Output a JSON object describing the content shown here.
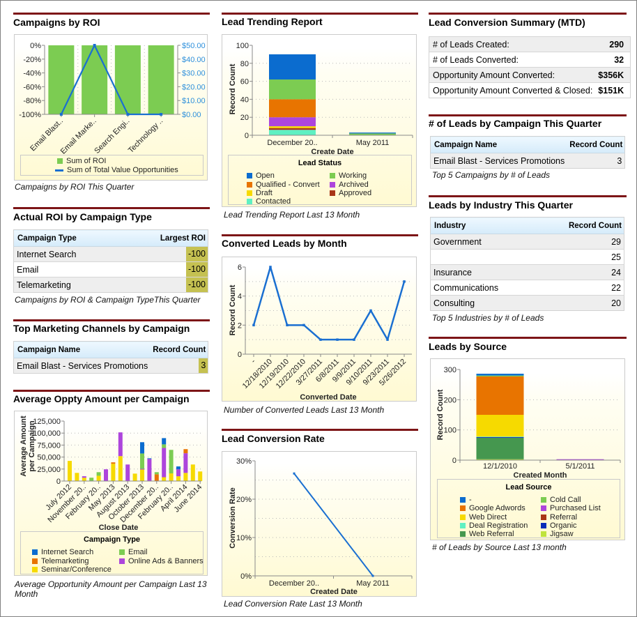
{
  "theme": {
    "section_rule": "#7d1517",
    "highlight_cell": "#c5c151"
  },
  "campaigns_by_roi": {
    "title": "Campaigns by ROI",
    "caption": "Campaigns by ROI This Quarter"
  },
  "actual_roi": {
    "title": "Actual ROI by Campaign Type",
    "columns": [
      "Campaign Type",
      "Largest ROI"
    ],
    "rows": [
      [
        "Internet Search",
        "-100"
      ],
      [
        "Email",
        "-100"
      ],
      [
        "Telemarketing",
        "-100"
      ]
    ],
    "caption": "Campaigns by ROI & Campaign TypeThis Quarter"
  },
  "top_channels": {
    "title": "Top Marketing Channels by Campaign",
    "columns": [
      "Campaign Name",
      "Record Count"
    ],
    "rows": [
      [
        "Email Blast - Services Promotions",
        "3"
      ]
    ]
  },
  "avg_oppty": {
    "title": "Average Oppty Amount per Campaign",
    "caption": "Average Opportunity Amount per Campaign Last 13 Month"
  },
  "lead_trending": {
    "title": "Lead Trending Report",
    "caption": "Lead Trending Report Last 13 Month"
  },
  "converted_leads": {
    "title": "Converted Leads by Month",
    "caption": "Number of Converted Leads Last 13 Month"
  },
  "conversion_rate": {
    "title": "Lead Conversion Rate",
    "caption": "Lead Conversion Rate Last 13 Month"
  },
  "conversion_summary": {
    "title": "Lead Conversion Summary (MTD)",
    "rows": [
      [
        "# of Leads Created:",
        "290"
      ],
      [
        "# of Leads Converted:",
        "32"
      ],
      [
        "Opportunity Amount Converted:",
        "$356K"
      ],
      [
        "Opportunity Amount Converted & Closed:",
        "$151K"
      ]
    ]
  },
  "leads_by_campaign": {
    "title": "# of Leads by Campaign This Quarter",
    "columns": [
      "Campaign Name",
      "Record Count"
    ],
    "rows": [
      [
        "Email Blast - Services Promotions",
        "3"
      ]
    ],
    "caption": "Top 5 Campaigns by # of Leads"
  },
  "leads_by_industry": {
    "title": "Leads by Industry This Quarter",
    "columns": [
      "Industry",
      "Record Count"
    ],
    "rows": [
      [
        "Government",
        "29"
      ],
      [
        "",
        "25"
      ],
      [
        "Insurance",
        "24"
      ],
      [
        "Communications",
        "22"
      ],
      [
        "Consulting",
        "20"
      ]
    ],
    "caption": "Top 5 Industries by # of Leads"
  },
  "leads_by_source": {
    "title": "Leads by Source",
    "caption": "# of Leads by Source Last 13 month"
  },
  "chart_data": [
    {
      "type": "bar+line",
      "title": "Campaigns by ROI",
      "categories": [
        "Email Blast..",
        "Email Marke..",
        "Search Engi..",
        "Technology .."
      ],
      "series": [
        {
          "name": "Sum of ROI",
          "kind": "bar",
          "axis": "left",
          "color": "#7ccc52",
          "values": [
            -100,
            -100,
            -100,
            -100
          ]
        },
        {
          "name": "Sum of Total Value Opportunities",
          "kind": "line",
          "axis": "right",
          "color": "#1a6fd1",
          "values": [
            0,
            50,
            0,
            0
          ]
        }
      ],
      "y_left": {
        "min": -100,
        "max": 0,
        "ticks": [
          0,
          -20,
          -40,
          -60,
          -80,
          -100
        ],
        "tick_labels": [
          "0%",
          "-20%",
          "-40%",
          "-60%",
          "-80%",
          "-100%"
        ]
      },
      "y_right": {
        "min": 0,
        "max": 50,
        "ticks": [
          50,
          40,
          30,
          20,
          10,
          0
        ],
        "tick_labels": [
          "$50.00",
          "$40.00",
          "$30.00",
          "$20.00",
          "$10.00",
          "$0.00"
        ],
        "color": "#2d8fdb"
      },
      "legend": {
        "position": "bottom"
      }
    },
    {
      "type": "bar",
      "stacked": true,
      "title": "Lead Trending Report",
      "categories": [
        "December 20..",
        "May 2011"
      ],
      "xlabel": "Create Date",
      "ylabel": "Record Count",
      "y": {
        "min": 0,
        "max": 100,
        "ticks": [
          0,
          20,
          40,
          60,
          80,
          100
        ],
        "tick_labels": [
          "0",
          "20",
          "40",
          "60",
          "80",
          "100"
        ],
        "gridlines": [
          20,
          40,
          60,
          80
        ]
      },
      "legend": {
        "title": "Lead Status",
        "position": "bottom"
      },
      "series": [
        {
          "name": "Open",
          "color": "#0b6ccf",
          "values": [
            28,
            1
          ]
        },
        {
          "name": "Working",
          "color": "#7ccc52",
          "values": [
            22,
            2
          ]
        },
        {
          "name": "Qualified - Convert",
          "color": "#e87400",
          "values": [
            20,
            0
          ]
        },
        {
          "name": "Archived",
          "color": "#ad45dc",
          "values": [
            10,
            0
          ]
        },
        {
          "name": "Draft",
          "color": "#f6da00",
          "values": [
            2,
            0
          ]
        },
        {
          "name": "Approved",
          "color": "#a83517",
          "values": [
            2,
            0
          ]
        },
        {
          "name": "Contacted",
          "color": "#5ff0c2",
          "values": [
            6,
            0
          ]
        }
      ]
    },
    {
      "type": "line",
      "title": "Converted Leads by Month",
      "categories": [
        "-",
        "12/18/2010",
        "12/19/2010",
        "12/22/2010",
        "3/27/2011",
        "6/8/2011",
        "9/9/2011",
        "9/10/2011",
        "9/23/2011",
        "5/26/2012"
      ],
      "xlabel": "Converted Date",
      "ylabel": "Record Count",
      "y": {
        "min": 0,
        "max": 6,
        "ticks": [
          0,
          2,
          4,
          6
        ],
        "tick_labels": [
          "0",
          "2",
          "4",
          "6"
        ],
        "gridlines": [
          1,
          2,
          3,
          4,
          5
        ]
      },
      "series": [
        {
          "name": "Record Count",
          "color": "#1a6fd1",
          "values": [
            2,
            6,
            2,
            2,
            1,
            1,
            1,
            3,
            1,
            5
          ]
        }
      ]
    },
    {
      "type": "line",
      "title": "Lead Conversion Rate",
      "categories": [
        "December 20..",
        "May 2011"
      ],
      "xlabel": "Created Date",
      "ylabel": "Conversion Rate",
      "y": {
        "min": 0,
        "max": 30,
        "ticks": [
          0,
          10,
          20,
          30
        ],
        "tick_labels": [
          "0%",
          "10%",
          "20%",
          "30%"
        ],
        "gridlines": [
          5,
          10,
          15,
          20,
          25
        ]
      },
      "series": [
        {
          "name": "Conversion Rate",
          "color": "#1a6fd1",
          "values": [
            26.7,
            0
          ]
        }
      ]
    },
    {
      "type": "bar",
      "stacked": true,
      "title": "Average Oppty Amount per Campaign",
      "categories": [
        "July 2012",
        "",
        "November 20..",
        "",
        "February 20..",
        "",
        "May 2013",
        "",
        "August 2013",
        "",
        "October 2013",
        "",
        "December 20..",
        "",
        "February 20..",
        "",
        "April 2014",
        "",
        "June 2014"
      ],
      "xlabel": "Close Date",
      "ylabel_lines": [
        "Average Amount",
        "per Campaign"
      ],
      "y": {
        "min": 0,
        "max": 125000,
        "ticks": [
          0,
          25000,
          50000,
          75000,
          100000,
          125000
        ],
        "tick_labels": [
          "0",
          "25,000",
          "50,000",
          "75,000",
          "100,000",
          "125,000"
        ],
        "gridlines": [
          25000,
          50000,
          75000,
          100000
        ]
      },
      "legend": {
        "title": "Campaign Type",
        "position": "bottom"
      },
      "series": [
        {
          "name": "Internet Search",
          "color": "#0b6ccf",
          "values": [
            0,
            0,
            0,
            0,
            0,
            0,
            0,
            0,
            0,
            0,
            23500,
            1500,
            0,
            13000,
            0,
            6000,
            0,
            0,
            0
          ]
        },
        {
          "name": "Email",
          "color": "#7ccc52",
          "values": [
            0,
            0,
            0,
            7000,
            7500,
            0,
            0,
            0,
            0,
            0,
            32000,
            0,
            4500,
            7500,
            49000,
            0,
            0,
            0,
            0
          ]
        },
        {
          "name": "Telemarketing",
          "color": "#e87400",
          "values": [
            0,
            0,
            0,
            0,
            0,
            0,
            3000,
            0,
            0,
            0,
            0,
            0,
            14000,
            0,
            0,
            0,
            8500,
            0,
            0
          ]
        },
        {
          "name": "Online Ads & Banners",
          "color": "#ad45dc",
          "values": [
            0,
            0,
            3000,
            0,
            0,
            24500,
            0,
            49500,
            34500,
            0,
            1500,
            46000,
            0,
            61000,
            0,
            14500,
            41000,
            0,
            0
          ]
        },
        {
          "name": "Seminar/Conference",
          "color": "#f6da00",
          "values": [
            42000,
            17000,
            7000,
            0,
            11000,
            0,
            36000,
            52000,
            0,
            15500,
            24000,
            0,
            0,
            8000,
            16000,
            10000,
            17000,
            34500,
            20000
          ]
        }
      ]
    },
    {
      "type": "bar",
      "stacked": true,
      "title": "Leads by Source",
      "categories": [
        "12/1/2010",
        "5/1/2011"
      ],
      "xlabel": "Created Month",
      "ylabel": "Record Count",
      "y": {
        "min": 0,
        "max": 300,
        "ticks": [
          0,
          100,
          200,
          300
        ],
        "tick_labels": [
          "0",
          "100",
          "200",
          "300"
        ],
        "gridlines": [
          100,
          200
        ]
      },
      "legend": {
        "title": "Lead Source",
        "position": "bottom"
      },
      "series": [
        {
          "name": "-",
          "color": "#0b6ccf",
          "values": [
            6,
            0
          ]
        },
        {
          "name": "Cold Call",
          "color": "#7ccc52",
          "values": [
            3,
            0
          ]
        },
        {
          "name": "Google Adwords",
          "color": "#e87400",
          "values": [
            127,
            0
          ]
        },
        {
          "name": "Purchased List",
          "color": "#ad45dc",
          "values": [
            0,
            3
          ]
        },
        {
          "name": "Web Direct",
          "color": "#f6da00",
          "values": [
            72,
            0
          ]
        },
        {
          "name": "Referral",
          "color": "#a83517",
          "values": [
            0,
            0
          ]
        },
        {
          "name": "Deal Registration",
          "color": "#5ff0c2",
          "values": [
            1,
            0
          ]
        },
        {
          "name": "Organic",
          "color": "#0a2db8",
          "values": [
            3,
            0
          ]
        },
        {
          "name": "Web Referral",
          "color": "#45974f",
          "values": [
            71,
            0
          ]
        },
        {
          "name": "Jigsaw",
          "color": "#bfe33b",
          "values": [
            3,
            0
          ]
        }
      ]
    }
  ]
}
